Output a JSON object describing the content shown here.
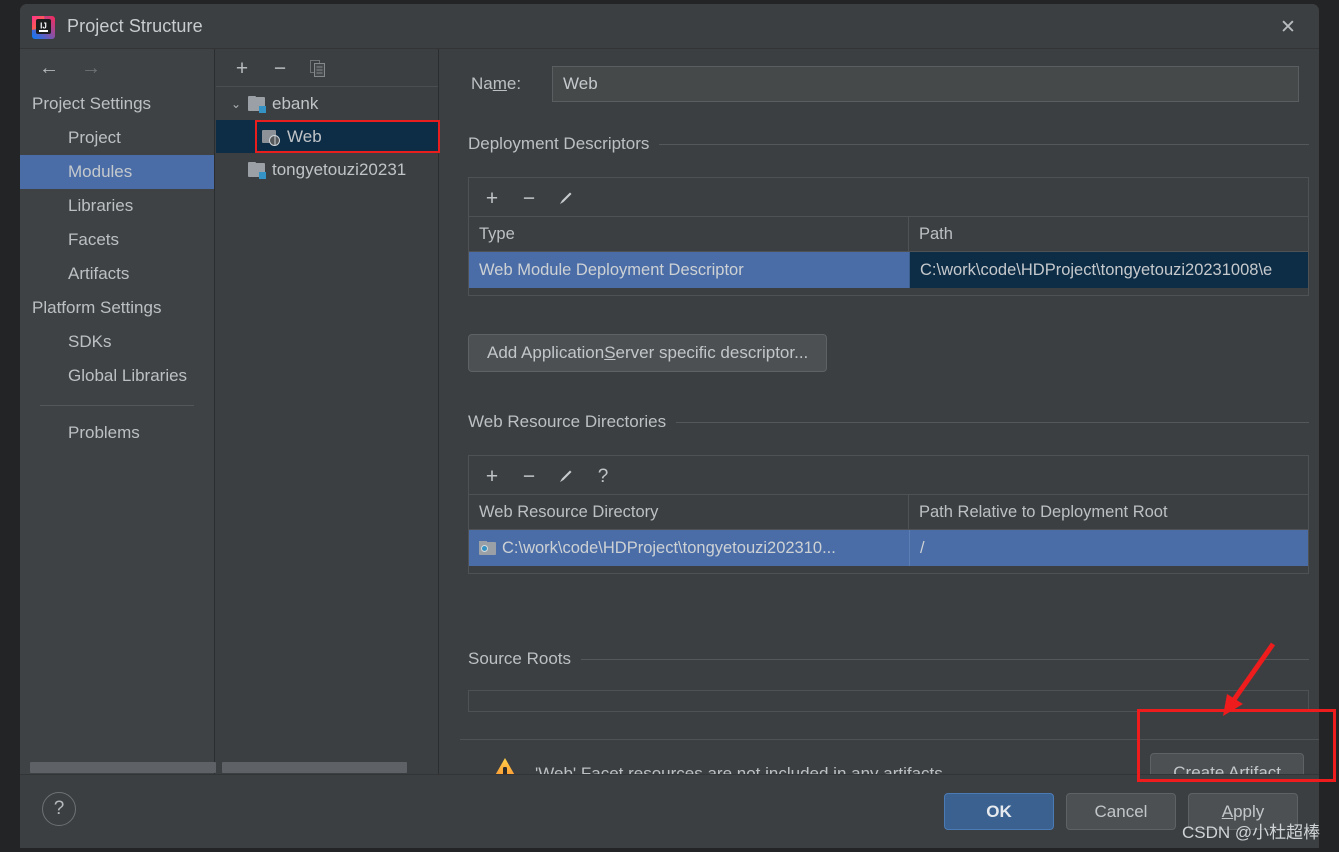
{
  "window": {
    "title": "Project Structure",
    "logo_icon": "intellij-idea-logo",
    "close_icon": "✕"
  },
  "sidebar": {
    "nav": {
      "back_icon": "←",
      "forward_icon": "→"
    },
    "items": [
      {
        "label": "Project Settings",
        "type": "group"
      },
      {
        "label": "Project",
        "type": "child"
      },
      {
        "label": "Modules",
        "type": "child",
        "selected": true
      },
      {
        "label": "Libraries",
        "type": "child"
      },
      {
        "label": "Facets",
        "type": "child"
      },
      {
        "label": "Artifacts",
        "type": "child"
      },
      {
        "label": "Platform Settings",
        "type": "group"
      },
      {
        "label": "SDKs",
        "type": "child"
      },
      {
        "label": "Global Libraries",
        "type": "child"
      },
      {
        "label": "Problems",
        "type": "child",
        "after_separator": true
      }
    ]
  },
  "tree": {
    "toolbar": {
      "add_icon": "+",
      "remove_icon": "−",
      "copy_icon": "copy-icon"
    },
    "nodes": [
      {
        "label": "ebank",
        "icon": "folder-module-icon",
        "expanded": true,
        "chevron": "⌄"
      },
      {
        "label": "Web",
        "icon": "web-facet-icon",
        "selected": true,
        "highlighted": true
      },
      {
        "label": "tongyetouzi20231",
        "icon": "folder-module-icon"
      }
    ]
  },
  "main": {
    "name": {
      "label_pre": "Na",
      "label_mn": "m",
      "label_post": "e:",
      "value": "Web"
    },
    "deployment_descriptors": {
      "title": "Deployment Descriptors",
      "toolbar": {
        "add_icon": "+",
        "remove_icon": "−",
        "edit_icon": "✎"
      },
      "columns": [
        "Type",
        "Path"
      ],
      "rows": [
        {
          "type": "Web Module Deployment Descriptor",
          "path": "C:\\work\\code\\HDProject\\tongyetouzi20231008\\e",
          "selected": true
        }
      ],
      "add_server_button": {
        "pre": "Add Application ",
        "mn": "S",
        "post": "erver specific descriptor..."
      }
    },
    "web_resource_directories": {
      "title": "Web Resource Directories",
      "toolbar": {
        "add_icon": "+",
        "remove_icon": "−",
        "edit_icon": "✎",
        "help_icon": "?"
      },
      "columns": [
        "Web Resource Directory",
        "Path Relative to Deployment Root"
      ],
      "rows": [
        {
          "directory": "C:\\work\\code\\HDProject\\tongyetouzi202310...",
          "relative_path": "/",
          "icon": "source-folder-icon",
          "selected": true
        }
      ]
    },
    "source_roots": {
      "title": "Source Roots"
    },
    "warning": {
      "icon": "warning-triangle-icon",
      "message": "'Web' Facet resources are not included in any artifacts",
      "action_button": {
        "pre": "Create Arti",
        "mn": "f",
        "post": "act"
      }
    }
  },
  "bottom": {
    "help_icon": "?",
    "ok_label": "OK",
    "cancel_label": "Cancel",
    "apply": {
      "mn": "A",
      "post": "pply"
    }
  },
  "watermark": {
    "text": "CSDN @小杜超棒"
  },
  "colors": {
    "dialog_bg": "#3c3f41",
    "sidebar_bg": "#3f4245",
    "selection_blue": "#4a6da7",
    "focus_navy": "#0d2c46",
    "accent_red": "#ee1c1c",
    "ok_blue": "#3a618f",
    "warning_amber": "#f5a623",
    "text": "#bcc0c3"
  }
}
